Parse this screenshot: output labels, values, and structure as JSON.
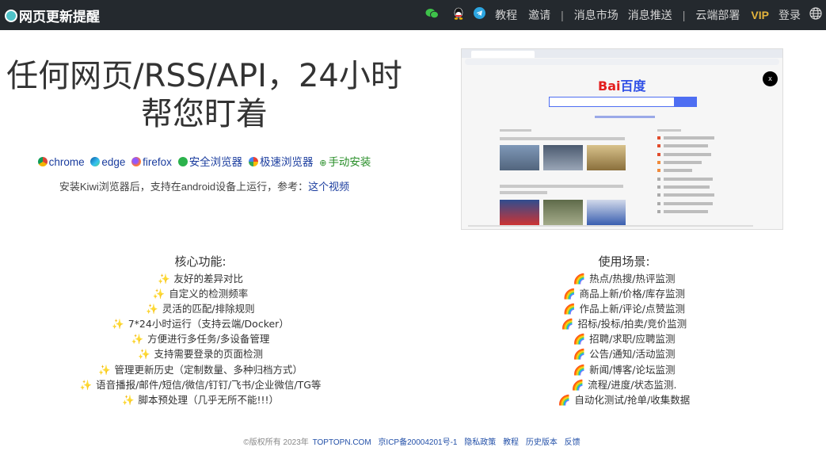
{
  "brand": {
    "name": "网页更新提醒"
  },
  "nav": {
    "icons": [
      "wechat-icon",
      "qq-icon",
      "telegram-icon"
    ],
    "tutorial": "教程",
    "invite": "邀请",
    "sep1": "|",
    "msg_market": "消息市场",
    "msg_push": "消息推送",
    "sep2": "|",
    "cloud": "云端部署",
    "vip": "VIP",
    "login": "登录",
    "lang_icon": "globe-icon"
  },
  "hero": {
    "title_line1": "任何网页/RSS/API，24小时",
    "title_line2": "帮您盯着"
  },
  "browsers": {
    "chrome": "chrome",
    "edge": "edge",
    "firefox": "firefox",
    "safe": "安全浏览器",
    "fast": "极速浏览器",
    "manual": "手动安装"
  },
  "install": {
    "text_before": "安装Kiwi浏览器后，支持在android设备上运行，参考：",
    "video_link": "这个视频"
  },
  "preview": {
    "logo_a": "Bai",
    "logo_b": "百度",
    "close": "x"
  },
  "features": {
    "title": "核心功能:",
    "items": [
      "友好的差异对比",
      "自定义的检测频率",
      "灵活的匹配/排除规则",
      "7*24小时运行（支持云端/Docker）",
      "方便进行多任务/多设备管理",
      "支持需要登录的页面检测",
      "管理更新历史（定制数量、多种归档方式）",
      "语音播报/邮件/短信/微信/钉钉/飞书/企业微信/TG等",
      "脚本预处理（几乎无所不能!!!）"
    ]
  },
  "scenarios": {
    "title": "使用场景:",
    "items": [
      "热点/热搜/热评监测",
      "商品上新/价格/库存监测",
      "作品上新/评论/点赞监测",
      "招标/投标/拍卖/竞价监测",
      "招聘/求职/应聘监测",
      "公告/通知/活动监测",
      "新闻/博客/论坛监测",
      "流程/进度/状态监测.",
      "自动化测试/抢单/收集数据"
    ]
  },
  "footer": {
    "copyright": "©版权所有 2023年",
    "site": "TOPTOPN.COM",
    "icp": "京ICP备20004201号-1",
    "privacy": "隐私政策",
    "tutorial": "教程",
    "history": "历史版本",
    "feedback": "反馈"
  },
  "colors": {
    "topbar": "#24292e",
    "link": "#1a3c9e",
    "vip": "#e3b33c"
  }
}
